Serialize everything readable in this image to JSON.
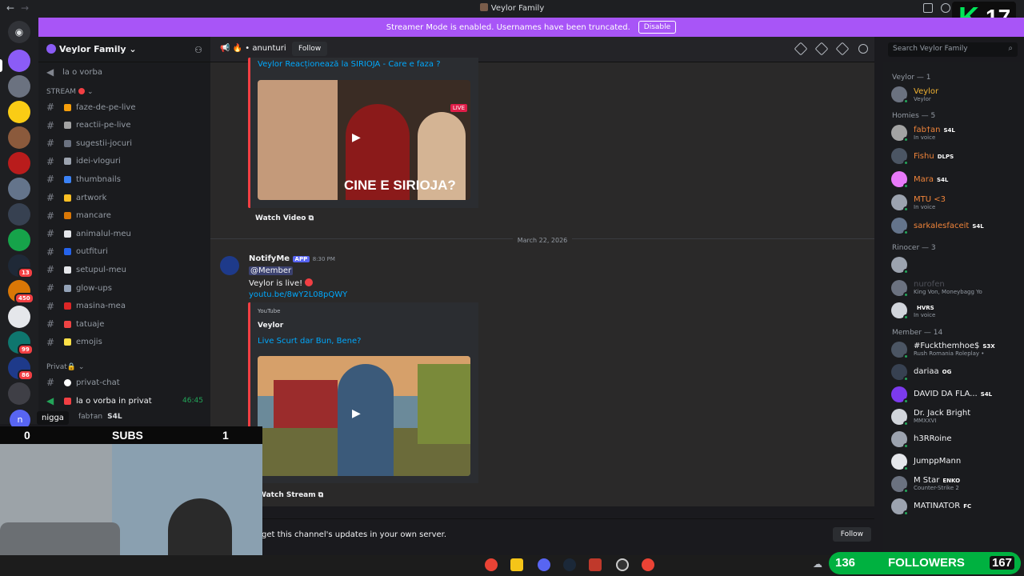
{
  "titlebar": {
    "title": "Veylor Family"
  },
  "kick_badge": {
    "letter": "K",
    "count": "17"
  },
  "banner": {
    "text": "Streamer Mode is enabled. Usernames have been truncated.",
    "button": "Disable"
  },
  "server": {
    "name": "Veylor Family ⌄"
  },
  "channels": {
    "top_voice": "la o vorba",
    "stream_category": "STREAM",
    "items": [
      "faze-de-pe-live",
      "reactii-pe-live",
      "sugestii-jocuri",
      "idei-vloguri",
      "thumbnails",
      "artwork",
      "mancare",
      "animalul-meu",
      "outfituri",
      "setupul-meu",
      "glow-ups",
      "masina-mea",
      "tatuaje",
      "emojis"
    ],
    "private_category": "Privat🔒",
    "private_chat": "privat-chat",
    "private_voice": "la o vorba in privat",
    "private_voice_time": "46:45",
    "voice_user": "fab†an",
    "voice_user_tag": "S4L",
    "tooltip": "nigga",
    "avatar_letter": "n"
  },
  "chatbar": {
    "channel": "anunturi",
    "follow": "Follow"
  },
  "search": {
    "placeholder": "Search Veylor Family"
  },
  "messages": {
    "embed1_title": "Veylor Reacționează la SIRIOJA - Care e faza ?",
    "embed1_thumb_text": "CINE E SIRIOJA?",
    "embed1_live": "LIVE",
    "watch_video": "Watch Video",
    "date_divider": "March 22, 2026",
    "author": "NotifyMe",
    "app_tag": "APP",
    "time": "8:30 PM",
    "mention": "@Member",
    "live_text": "Veylor is live!",
    "link": "youtu.be/8wY2L08pQWY",
    "embed2_provider": "YouTube",
    "embed2_author": "Veylor",
    "embed2_title": "Live Scurt dar Bun, Bene?",
    "watch_stream": "Watch Stream"
  },
  "bottom": {
    "text": "get this channel's updates in your own server.",
    "follow": "Follow"
  },
  "members": {
    "sections": [
      "Veylor — 1",
      "Homies — 5",
      "Rinocer — 3",
      "Member — 14"
    ],
    "veylor": [
      {
        "name": "Veylor",
        "sub": "Veylor",
        "color": "#f0b232"
      }
    ],
    "homies": [
      {
        "name": "fab†an",
        "tag": "S4L",
        "sub": "In voice",
        "color": "#f0843a"
      },
      {
        "name": "Fishu",
        "tag": "DLPS",
        "sub": "",
        "color": "#f0843a"
      },
      {
        "name": "Mara",
        "tag": "S4L",
        "sub": "",
        "color": "#f0843a"
      },
      {
        "name": "MTU <3",
        "tag": "",
        "sub": "In voice",
        "color": "#f0843a"
      },
      {
        "name": "sarkalesfaceit",
        "tag": "S4L",
        "sub": "",
        "color": "#f0843a"
      }
    ],
    "rinocer": [
      {
        "name": "",
        "tag": "",
        "sub": "",
        "color": "#949ba4"
      },
      {
        "name": "nurofen",
        "tag": "",
        "sub": "King Von, Moneybagg Yo",
        "color": "#4e5058"
      },
      {
        "name": "",
        "tag": "HVRS",
        "sub": "In voice",
        "color": "#949ba4"
      }
    ],
    "member": [
      {
        "name": "#Fuckthemhoe$",
        "tag": "S3X",
        "sub": "Rush Romania Roleplay •",
        "color": "#f2f3f5"
      },
      {
        "name": "dariaa",
        "tag": "OG",
        "sub": "",
        "color": "#f2f3f5"
      },
      {
        "name": "DAVID DA FLA...",
        "tag": "S4L",
        "sub": "",
        "color": "#f2f3f5"
      },
      {
        "name": "Dr. Jack Bright",
        "tag": "",
        "sub": "MMXXVI",
        "color": "#f2f3f5"
      },
      {
        "name": "h3RRoine",
        "tag": "",
        "sub": "",
        "color": "#f2f3f5"
      },
      {
        "name": "JumppMann",
        "tag": "",
        "sub": "",
        "color": "#f2f3f5"
      },
      {
        "name": "M Star",
        "tag": "ENKO",
        "sub": "Counter-Strike 2",
        "color": "#f2f3f5"
      },
      {
        "name": "MATINATOR",
        "tag": "FC",
        "sub": "",
        "color": "#f2f3f5"
      }
    ]
  },
  "overlay": {
    "subs_left": "0",
    "subs_label": "SUBS",
    "subs_right": "1",
    "followers_left": "136",
    "followers_label": "FOLLOWERS",
    "followers_right": "167"
  },
  "colors": {
    "accent": "#a855f7",
    "link": "#00a8fc",
    "kick_green": "#00e559"
  }
}
